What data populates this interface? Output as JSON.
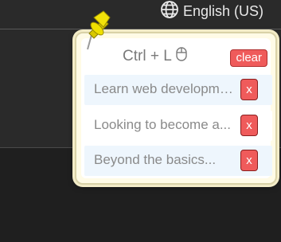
{
  "header": {
    "language_label": "English (US)",
    "icon": "globe-icon"
  },
  "popup": {
    "shortcut_label": "Ctrl + L",
    "shortcut_icon": "mouse-icon",
    "clear_label": "clear",
    "pin_icon": "pushpin-icon",
    "items": [
      {
        "text": "Learn web developme...",
        "remove_label": "x"
      },
      {
        "text": "Looking to become a...",
        "remove_label": "x"
      },
      {
        "text": "Beyond the basics...",
        "remove_label": "x"
      }
    ]
  },
  "colors": {
    "accent_red": "#ef5b5b",
    "popup_bg": "#fffbe6",
    "item_highlight": "#eef6fd"
  }
}
